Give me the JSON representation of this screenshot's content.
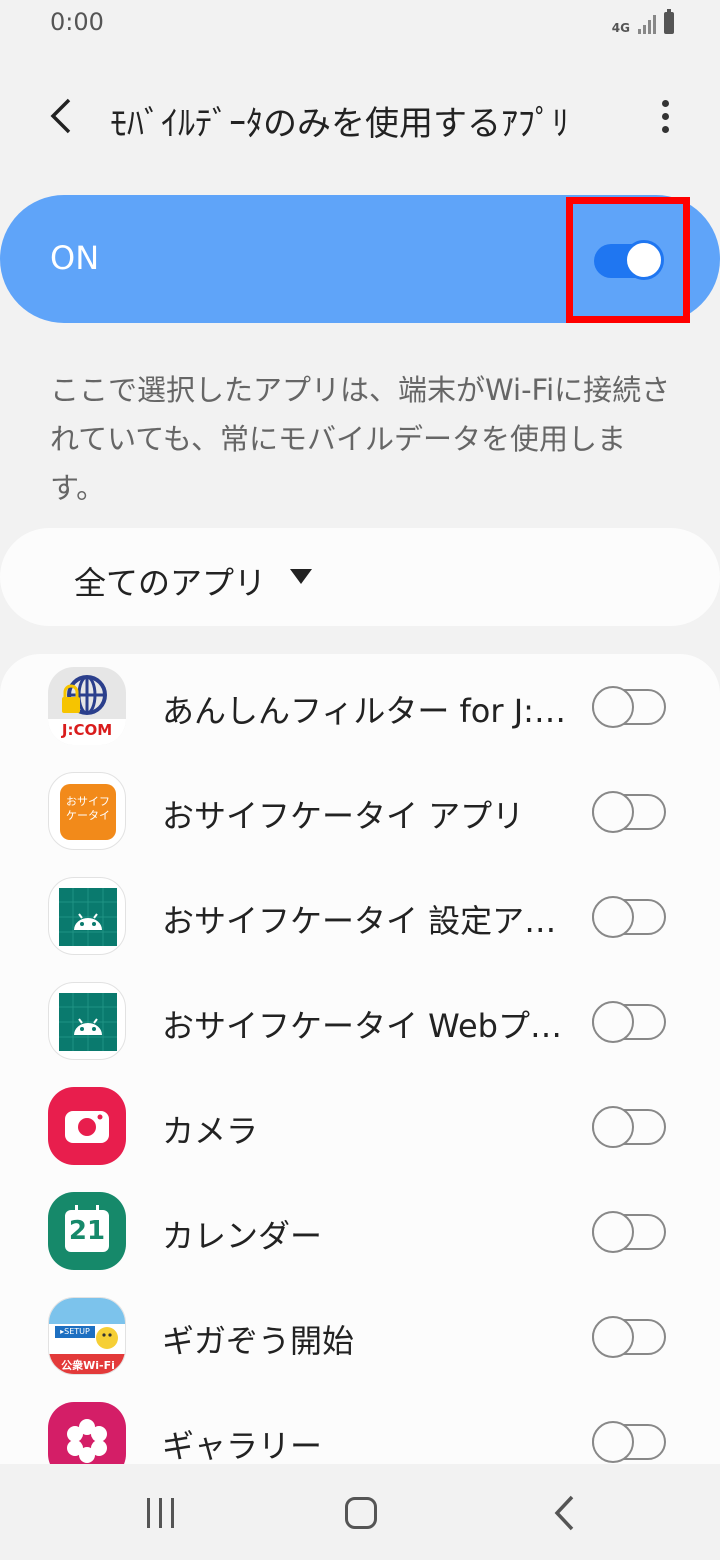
{
  "status_bar": {
    "time": "0:00",
    "network": "4G"
  },
  "header": {
    "title": "ﾓﾊﾞｲﾙﾃﾞｰﾀのみを使用するｱﾌﾟﾘ",
    "back_icon": "chevron-left-icon",
    "more_icon": "more-vert-icon"
  },
  "master_switch": {
    "label": "ON",
    "checked": true
  },
  "description": "ここで選択したアプリは、端末がWi-Fiに接続されていても、常にモバイルデータを使用します。",
  "filter": {
    "selected": "全てのアプリ"
  },
  "apps": [
    {
      "name": "あんしんフィルター for J:COM",
      "icon": "jcom-filter-icon",
      "enabled": false
    },
    {
      "name": "おサイフケータイ アプリ",
      "icon": "osaifu-keitai-icon",
      "enabled": false
    },
    {
      "name": "おサイフケータイ 設定アプリ",
      "icon": "android-settings-icon",
      "enabled": false
    },
    {
      "name": "おサイフケータイ Webプラグイン",
      "icon": "android-web-icon",
      "enabled": false
    },
    {
      "name": "カメラ",
      "icon": "camera-icon",
      "enabled": false
    },
    {
      "name": "カレンダー",
      "icon": "calendar-icon",
      "enabled": false
    },
    {
      "name": "ギガぞう開始",
      "icon": "gigazo-icon",
      "enabled": false
    },
    {
      "name": "ギャラリー",
      "icon": "gallery-icon",
      "enabled": false
    }
  ],
  "icon_texts": {
    "jcom": "J:COM",
    "osaifu": "おサイフ\nケータイ",
    "calendar_day": "21",
    "gigazo_setup": "▸SETUP",
    "gigazo_wifi": "公衆Wi-Fi"
  },
  "colors": {
    "accent": "#1f76f1",
    "master_bar": "#5fa4f9",
    "highlight": "#ff0000"
  },
  "nav_bar": {
    "recents_icon": "recents-icon",
    "home_icon": "home-icon",
    "back_icon": "back-icon"
  }
}
